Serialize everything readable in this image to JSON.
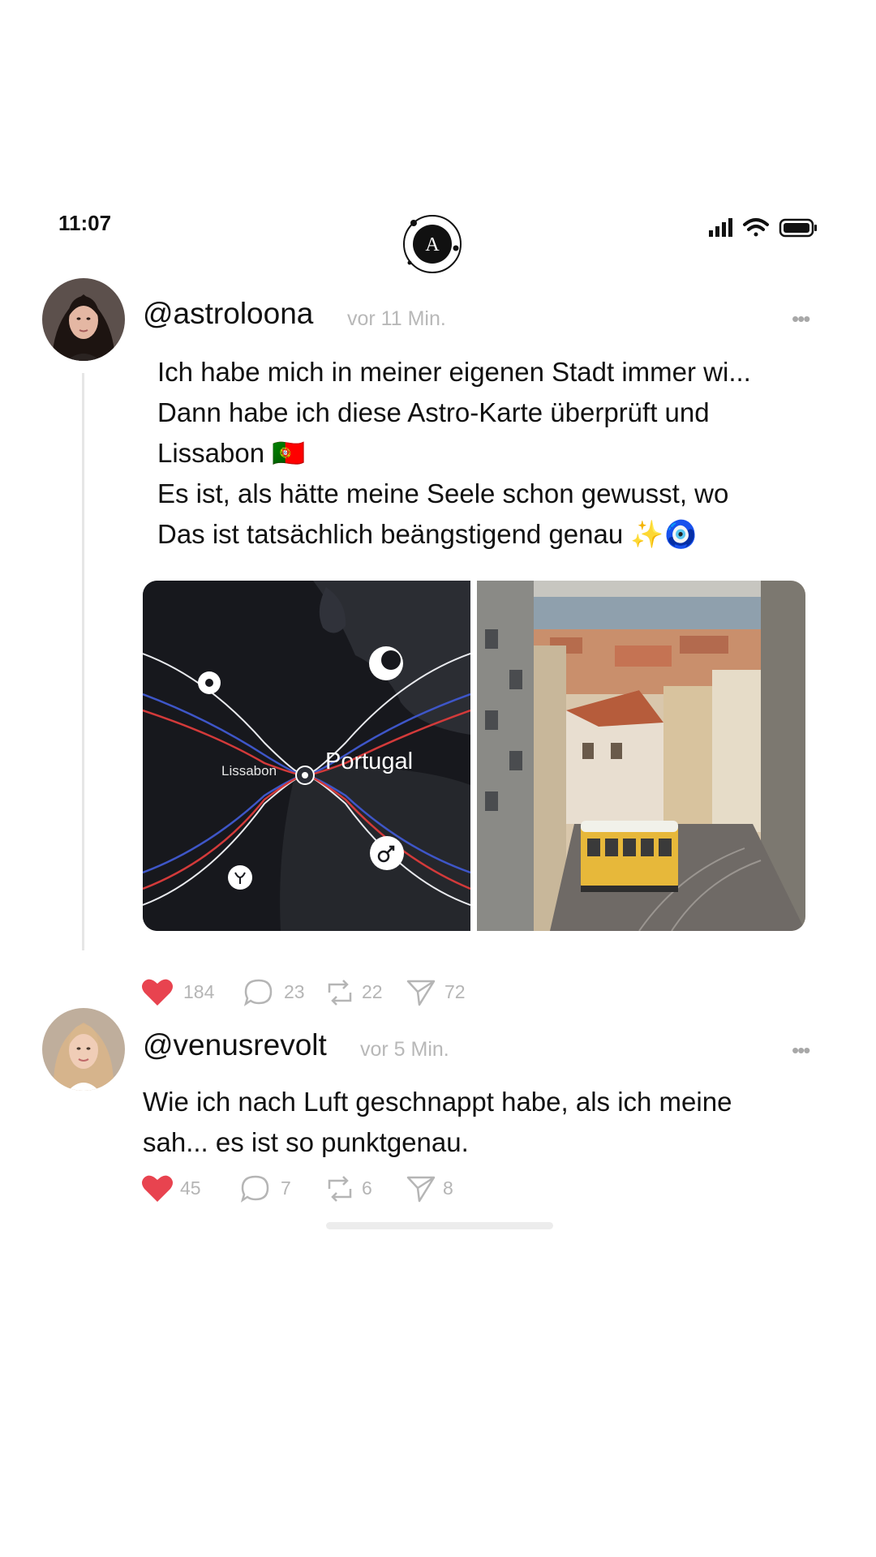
{
  "status_bar": {
    "time": "11:07",
    "logo_letter": "A"
  },
  "posts": [
    {
      "handle": "@astroloona",
      "time_ago": "vor 11 Min.",
      "more": "•••",
      "lines": [
        "Ich habe mich in meiner eigenen Stadt immer wi...",
        "Dann habe ich diese Astro-Karte überprüft und",
        "Lissabon 🇵🇹",
        "Es ist, als hätte meine Seele schon gewusst, wo",
        "Das ist tatsächlich beängstigend genau ✨🧿"
      ],
      "map_labels": {
        "city": "Lissabon",
        "country": "Portugal"
      },
      "stats": {
        "likes": "184",
        "comments": "23",
        "reposts": "22",
        "shares": "72"
      }
    },
    {
      "handle": "@venusrevolt",
      "time_ago": "vor 5 Min.",
      "more": "•••",
      "lines": [
        "Wie ich nach Luft geschnappt habe, als ich meine",
        "sah... es ist so punktgenau."
      ],
      "stats": {
        "likes": "45",
        "comments": "7",
        "reposts": "6",
        "shares": "8"
      }
    }
  ],
  "icons": {
    "like": "heart-icon",
    "comment": "comment-icon",
    "repost": "repost-icon",
    "share": "send-icon"
  },
  "colors": {
    "like": "#e8434f",
    "meta_text": "#b5b5b5",
    "map_red": "#d33a3a",
    "map_blue": "#3e56c8"
  }
}
